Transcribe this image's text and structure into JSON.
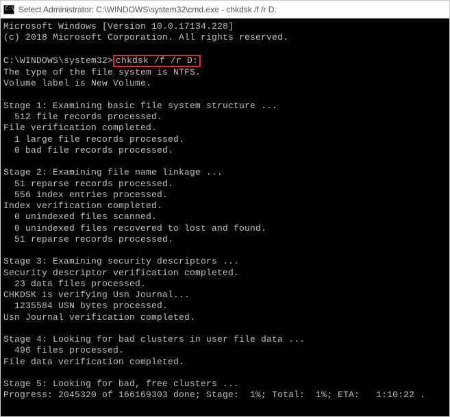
{
  "titlebar": {
    "icon_text": "C:\\",
    "title": "Select Administrator: C:\\WINDOWS\\system32\\cmd.exe - chkdsk  /f /r D:"
  },
  "terminal": {
    "header1": "Microsoft Windows [Version 10.0.17134.228]",
    "header2": "(c) 2018 Microsoft Corporation. All rights reserved.",
    "prompt": "C:\\WINDOWS\\system32>",
    "command": "chkdsk /f /r D:",
    "lines": {
      "l01": "The type of the file system is NTFS.",
      "l02": "Volume label is New Volume.",
      "l03": "",
      "l04": "Stage 1: Examining basic file system structure ...",
      "l05": "  512 file records processed.",
      "l06": "File verification completed.",
      "l07": "  1 large file records processed.",
      "l08": "  0 bad file records processed.",
      "l09": "",
      "l10": "Stage 2: Examining file name linkage ...",
      "l11": "  51 reparse records processed.",
      "l12": "  556 index entries processed.",
      "l13": "Index verification completed.",
      "l14": "  0 unindexed files scanned.",
      "l15": "  0 unindexed files recovered to lost and found.",
      "l16": "  51 reparse records processed.",
      "l17": "",
      "l18": "Stage 3: Examining security descriptors ...",
      "l19": "Security descriptor verification completed.",
      "l20": "  23 data files processed.",
      "l21": "CHKDSK is verifying Usn Journal...",
      "l22": "  1235584 USN bytes processed.",
      "l23": "Usn Journal verification completed.",
      "l24": "",
      "l25": "Stage 4: Looking for bad clusters in user file data ...",
      "l26": "  496 files processed.",
      "l27": "File data verification completed.",
      "l28": "",
      "l29": "Stage 5: Looking for bad, free clusters ...",
      "l30": "Progress: 2045320 of 166169303 done; Stage:  1%; Total:  1%; ETA:   1:10:22 ."
    }
  }
}
